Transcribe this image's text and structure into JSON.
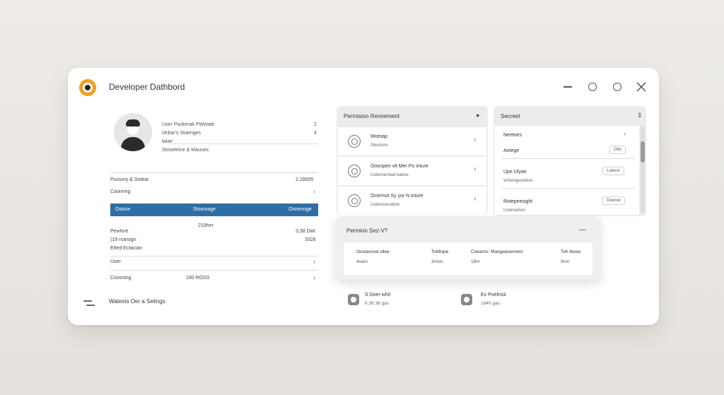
{
  "app": {
    "title": "Developer Dathbord"
  },
  "profile": {
    "lines": [
      "User Pockerak PWetale",
      "oKbar's Staenges",
      "talae",
      "Stoseteice & Mauues"
    ],
    "nums": [
      "2",
      "4"
    ]
  },
  "left_rows": [
    {
      "label": "Pussory & Sotear",
      "value": "2.28005"
    },
    {
      "label": "Coonring",
      "value": ""
    }
  ],
  "blue_bar": {
    "c1": "Osture",
    "c2": "Stoomage",
    "c3": "Oommoge"
  },
  "mid": {
    "center": "210her",
    "lines": [
      "Pewtore",
      "(19 noesign",
      "Etted Ectacian"
    ],
    "vals": [
      "3,38 Dwt",
      "3328"
    ]
  },
  "rows2": [
    {
      "label": "User",
      "value": ""
    },
    {
      "label": "Coosning",
      "value": "190 ROSS"
    }
  ],
  "footer": {
    "label": "Watests Oer a Setings"
  },
  "permission": {
    "title": "Permision Rennement",
    "items": [
      {
        "title": "Wotnap",
        "sub": "Stectore"
      },
      {
        "title": "Ooonpen vit Mer Po inture",
        "sub": "Ustementad katice"
      },
      {
        "title": "Ocermst Sy yor N inture",
        "sub": "Ustenoocation"
      }
    ]
  },
  "secret": {
    "title": "Secreet",
    "rows": [
      {
        "title": "Neetoes",
        "sub": ""
      },
      {
        "title": "Aotege",
        "sub": "",
        "btn": "Otto"
      },
      {
        "title": "Upe Ulyae",
        "sub": "Votengeoution",
        "btn": "Loenor"
      },
      {
        "title": "Rotepeesight",
        "sub": "Ustenetion",
        "btn": "Ooenor"
      }
    ]
  },
  "float_card": {
    "title": "Permion Sez-V?",
    "headers": [
      "Oostanced sllee",
      "Tottliope",
      "Coearns: Mangeanement",
      "Toh llwow"
    ],
    "values": [
      "4xam",
      "3mon",
      "18m",
      "9cm"
    ]
  },
  "stats": [
    {
      "title": "S Doer wh0",
      "sub": "6 28 38 gas"
    },
    {
      "title": "Ex Poelmol",
      "sub": "1840 gas"
    }
  ],
  "colors": {
    "accent": "#2f6ea5",
    "logo": "#f0a020"
  }
}
